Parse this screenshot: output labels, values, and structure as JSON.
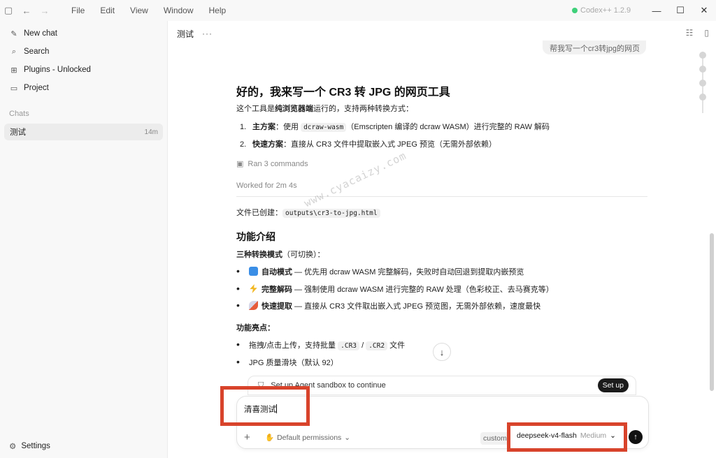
{
  "menu": [
    "File",
    "Edit",
    "View",
    "Window",
    "Help"
  ],
  "app_version": "Codex++ 1.2.9",
  "colors": {
    "status_dot": "#3fd07a",
    "highlight": "#d8432b",
    "send_button": "#111111"
  },
  "sidebar": {
    "items": [
      {
        "label": "New chat",
        "icon": "edit-icon"
      },
      {
        "label": "Search",
        "icon": "search-icon"
      },
      {
        "label": "Plugins - Unlocked",
        "icon": "grid-icon"
      },
      {
        "label": "Project",
        "icon": "folder-icon"
      }
    ],
    "chats_section": "Chats",
    "chats": [
      {
        "title": "测试",
        "time": "14m"
      }
    ],
    "settings_label": "Settings"
  },
  "header": {
    "title": "测试",
    "more": "···"
  },
  "conversation": {
    "user_message": "帮我写一个cr3转jpg的网页",
    "heading": "好的，我来写一个 CR3 转 JPG 的网页工具",
    "intro_before": "这个工具是",
    "intro_bold": "纯浏览器端",
    "intro_after": "运行的，支持两种转换方式：",
    "methods": [
      {
        "num": "1.",
        "bold": "主方案",
        "text_before": "：使用 ",
        "code": "dcraw-wasm",
        "text_after": "（Emscripten 编译的 dcraw WASM）进行完整的 RAW 解码"
      },
      {
        "num": "2.",
        "bold": "快速方案",
        "text_before": "：直接从 CR3 文件中提取嵌入式 JPEG 预览（无需外部依赖）",
        "code": "",
        "text_after": ""
      }
    ],
    "ran_commands": "Ran 3 commands",
    "worked_for": "Worked for 2m 4s",
    "file_created_label": "文件已创建：",
    "file_path": "outputs\\cr3-to-jpg.html",
    "features_heading": "功能介绍",
    "modes_label_bold": "三种转换模式",
    "modes_label_rest": "（可切换）：",
    "modes": [
      {
        "emoji": "refresh-emoji",
        "bold": "自动模式",
        "text": " — 优先用 dcraw WASM 完整解码，失败时自动回退到提取内嵌预览"
      },
      {
        "emoji": "lightning-emoji",
        "bold": "完整解码",
        "text": " — 强制使用 dcraw WASM 进行完整的 RAW 处理（色彩校正、去马赛克等）"
      },
      {
        "emoji": "rocket-emoji",
        "bold": "快速提取",
        "text": " — 直接从 CR3 文件取出嵌入式 JPEG 预览图，无需外部依赖，速度最快"
      }
    ],
    "highlights_label": "功能亮点：",
    "highlights": [
      {
        "before": "拖拽/点击上传，支持批量 ",
        "code1": ".CR3",
        "mid": " / ",
        "code2": ".CR2",
        "after": " 文件"
      },
      {
        "before": "JPG 质量滑块（默认 92）",
        "code1": "",
        "mid": "",
        "code2": "",
        "after": ""
      }
    ],
    "watermark": "www.cyacaizy.com"
  },
  "banner": {
    "text": "Set up Agent sandbox to continue",
    "button": "Set up"
  },
  "composer": {
    "value": "清喜测试",
    "permissions": "Default permissions",
    "custom": "custom",
    "model": "deepseek-v4-flash",
    "effort": "Medium"
  }
}
